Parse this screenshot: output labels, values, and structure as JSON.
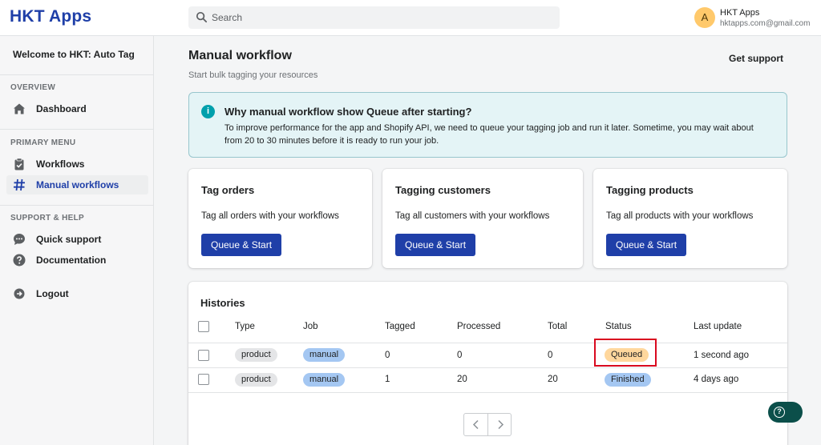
{
  "app": {
    "brand": "HKT Apps"
  },
  "search": {
    "placeholder": "Search"
  },
  "user": {
    "initial": "A",
    "name": "HKT Apps",
    "email": "hktapps.com@gmail.com"
  },
  "sidebar": {
    "welcome": "Welcome to HKT: Auto Tag",
    "sections": [
      {
        "heading": "OVERVIEW",
        "items": [
          {
            "label": "Dashboard",
            "icon": "home-icon"
          }
        ]
      },
      {
        "heading": "PRIMARY MENU",
        "items": [
          {
            "label": "Workflows",
            "icon": "clipboard-icon"
          },
          {
            "label": "Manual workflows",
            "icon": "hash-icon",
            "active": true
          }
        ]
      },
      {
        "heading": "SUPPORT & HELP",
        "items": [
          {
            "label": "Quick support",
            "icon": "chat-icon"
          },
          {
            "label": "Documentation",
            "icon": "question-icon"
          }
        ]
      }
    ],
    "logout": {
      "label": "Logout",
      "icon": "logout-icon"
    }
  },
  "page": {
    "title": "Manual workflow",
    "subtitle": "Start bulk tagging your resources",
    "get_support": "Get support"
  },
  "banner": {
    "title": "Why manual workflow show Queue after starting?",
    "body": "To improve performance for the app and Shopify API, we need to queue your tagging job and run it later. Sometime, you may wait about from 20 to 30 minutes before it is ready to run your job."
  },
  "cards": [
    {
      "title": "Tag orders",
      "description": "Tag all orders with your workflows",
      "button": "Queue & Start"
    },
    {
      "title": "Tagging customers",
      "description": "Tag all customers with your workflows",
      "button": "Queue & Start"
    },
    {
      "title": "Tagging products",
      "description": "Tag all products with your workflows",
      "button": "Queue & Start"
    }
  ],
  "histories": {
    "title": "Histories",
    "columns": [
      "Type",
      "Job",
      "Tagged",
      "Processed",
      "Total",
      "Status",
      "Last update"
    ],
    "rows": [
      {
        "type": "product",
        "job": "manual",
        "tagged": "0",
        "processed": "0",
        "total": "0",
        "status": "Queued",
        "last_update": "1 second ago"
      },
      {
        "type": "product",
        "job": "manual",
        "tagged": "1",
        "processed": "20",
        "total": "20",
        "status": "Finished",
        "last_update": "4 days ago"
      }
    ]
  },
  "colors": {
    "brand": "#1f3fa8",
    "queued": "#ffd79d",
    "finished": "#a4c7f2",
    "info": "#00a0ac",
    "highlight": "#d9091f"
  }
}
